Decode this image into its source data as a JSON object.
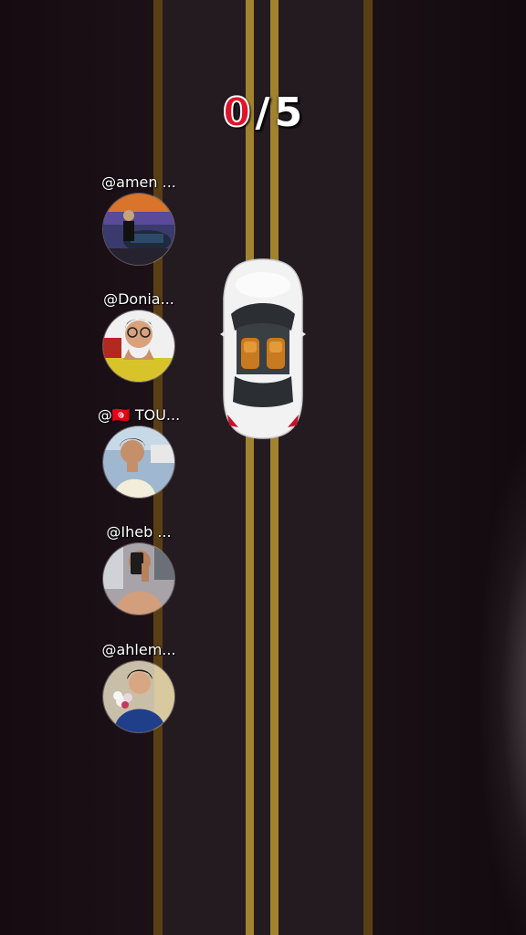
{
  "score": {
    "current": "0",
    "separator": "/",
    "total": "5"
  },
  "players": [
    {
      "name": "@amen ...",
      "avatar_icon": "avatar-man-with-car"
    },
    {
      "name": "@Donia...",
      "avatar_icon": "avatar-woman-with-glasses"
    },
    {
      "name": "@🇹🇳 TOU...",
      "avatar_icon": "avatar-young-man"
    },
    {
      "name": "@Iheb ...",
      "avatar_icon": "avatar-selfie-phone"
    },
    {
      "name": "@ahlem...",
      "avatar_icon": "avatar-woman-with-flowers"
    }
  ],
  "colors": {
    "road": "#241b21",
    "center_line": "#a1832f",
    "edge_line": "#5a3f16",
    "score_accent": "#e0132a"
  }
}
